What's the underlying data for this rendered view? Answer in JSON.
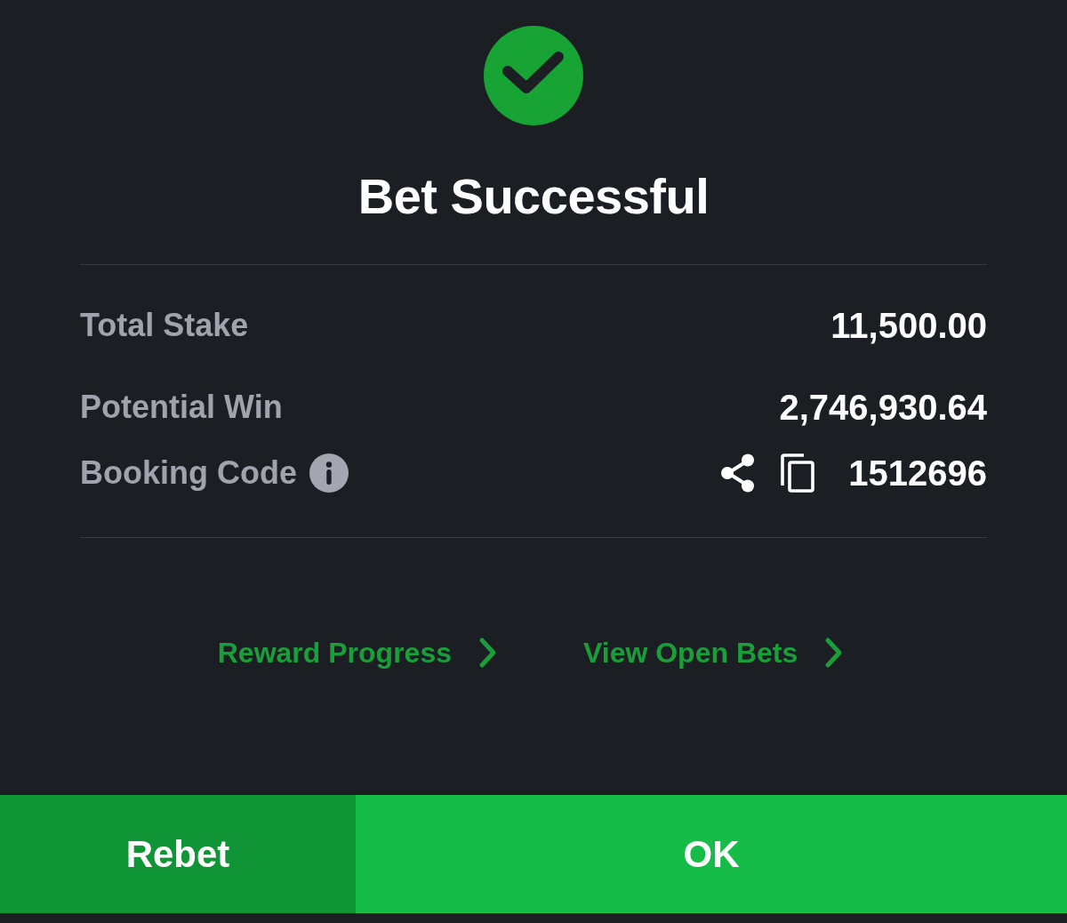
{
  "status": {
    "title": "Bet Successful"
  },
  "details": [
    {
      "label": "Total Stake",
      "value": "11,500.00",
      "kind": "plain"
    },
    {
      "label": "Potential Win",
      "value": "2,746,930.64",
      "kind": "plain"
    },
    {
      "label": "Booking Code",
      "value": "1512696",
      "kind": "code"
    }
  ],
  "links": [
    {
      "label": "Reward Progress"
    },
    {
      "label": "View Open Bets"
    }
  ],
  "buttons": [
    {
      "label": "Rebet",
      "kind": "secondary"
    },
    {
      "label": "OK",
      "kind": "primary"
    }
  ]
}
